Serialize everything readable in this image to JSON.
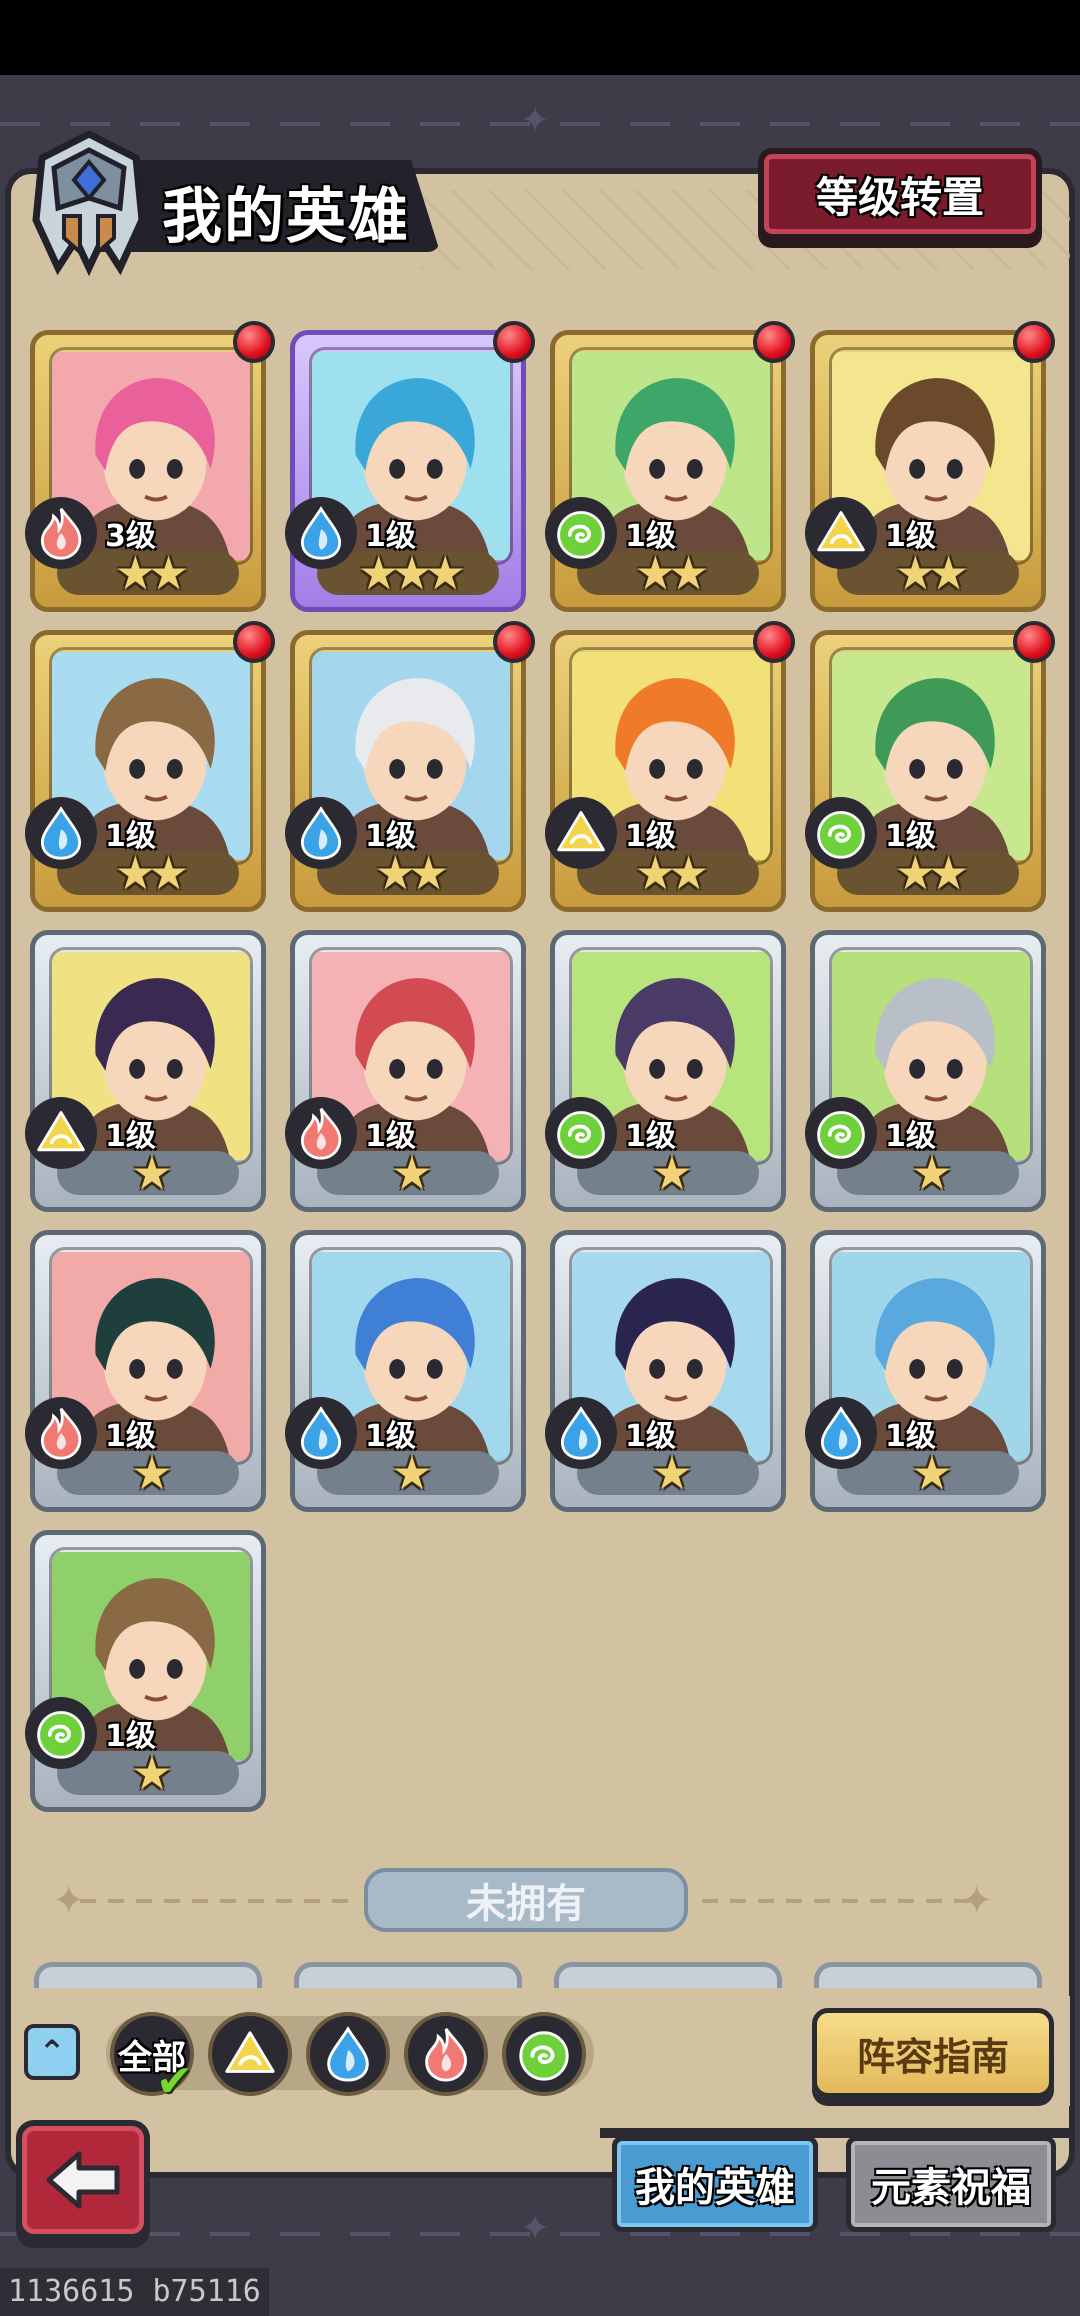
{
  "header": {
    "title": "我的英雄",
    "level_transfer_label": "等级转置"
  },
  "colors": {
    "fire": "#f07a73",
    "water": "#3aa3e8",
    "wind": "#6ed13c",
    "earth": "#f2d54a",
    "card_gold": "#ecd17a",
    "card_purple": "#b795f2",
    "card_silver": "#d7dde3",
    "notify_red": "#e0101e"
  },
  "owned_heroes": [
    {
      "level": "3级",
      "stars": "★★",
      "element": "fire",
      "rarity": "gold",
      "notify": true,
      "bg": "#f2a8ad",
      "hair": "#e9609a"
    },
    {
      "level": "1级",
      "stars": "★★★",
      "element": "water",
      "rarity": "purple",
      "notify": true,
      "bg": "#9fe0ee",
      "hair": "#3aa7d9"
    },
    {
      "level": "1级",
      "stars": "★★",
      "element": "wind",
      "rarity": "gold",
      "notify": true,
      "bg": "#bde58a",
      "hair": "#3fa66a"
    },
    {
      "level": "1级",
      "stars": "★★",
      "element": "earth",
      "rarity": "gold",
      "notify": true,
      "bg": "#f3e68f",
      "hair": "#6b4a2b"
    },
    {
      "level": "1级",
      "stars": "★★",
      "element": "water",
      "rarity": "gold",
      "notify": true,
      "bg": "#a9dcf0",
      "hair": "#8a6a44"
    },
    {
      "level": "1级",
      "stars": "★★",
      "element": "water",
      "rarity": "gold",
      "notify": true,
      "bg": "#a4d6ee",
      "hair": "#e8eaee"
    },
    {
      "level": "1级",
      "stars": "★★",
      "element": "earth",
      "rarity": "gold",
      "notify": true,
      "bg": "#f2e078",
      "hair": "#ef7a2a"
    },
    {
      "level": "1级",
      "stars": "★★",
      "element": "wind",
      "rarity": "gold",
      "notify": true,
      "bg": "#c8e890",
      "hair": "#3f9a58"
    },
    {
      "level": "1级",
      "stars": "★",
      "element": "earth",
      "rarity": "silver",
      "notify": false,
      "bg": "#f0e282",
      "hair": "#3a2a52"
    },
    {
      "level": "1级",
      "stars": "★",
      "element": "fire",
      "rarity": "silver",
      "notify": false,
      "bg": "#f4b2b4",
      "hair": "#d24a52"
    },
    {
      "level": "1级",
      "stars": "★",
      "element": "wind",
      "rarity": "silver",
      "notify": false,
      "bg": "#b8e47e",
      "hair": "#4a3a66"
    },
    {
      "level": "1级",
      "stars": "★",
      "element": "wind",
      "rarity": "silver",
      "notify": false,
      "bg": "#b6e07c",
      "hair": "#b9bfc6"
    },
    {
      "level": "1级",
      "stars": "★",
      "element": "fire",
      "rarity": "silver",
      "notify": false,
      "bg": "#f2aaa9",
      "hair": "#1f3f3c"
    },
    {
      "level": "1级",
      "stars": "★",
      "element": "water",
      "rarity": "silver",
      "notify": false,
      "bg": "#a2d8ee",
      "hair": "#3f7fd6"
    },
    {
      "level": "1级",
      "stars": "★",
      "element": "water",
      "rarity": "silver",
      "notify": false,
      "bg": "#a6d9ee",
      "hair": "#2a2450"
    },
    {
      "level": "1级",
      "stars": "★",
      "element": "water",
      "rarity": "silver",
      "notify": false,
      "bg": "#a0d6ea",
      "hair": "#5aa9de"
    },
    {
      "level": "1级",
      "stars": "★",
      "element": "wind",
      "rarity": "silver",
      "notify": false,
      "bg": "#8fd06a",
      "hair": "#8a6a44"
    }
  ],
  "unowned_label": "未拥有",
  "filters": {
    "all_label": "全部",
    "elements": [
      "earth",
      "water",
      "fire",
      "wind"
    ]
  },
  "team_guide_label": "阵容指南",
  "tabs": {
    "my_heroes": "我的英雄",
    "element_blessing": "元素祝福"
  },
  "debug_text": "1136615 b75116"
}
